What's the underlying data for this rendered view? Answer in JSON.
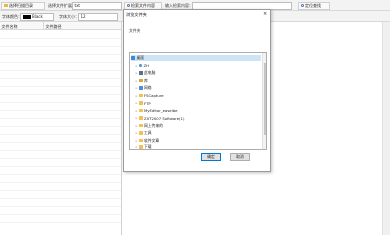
{
  "toolbar": {
    "select_dir_button": "选择扫描目录",
    "file_type_label": "选择文件扩展名：",
    "file_type_value": "txt",
    "search_button": "检索文件内容",
    "search_input_label": "输入检索内容：",
    "locate_button": "定位查找"
  },
  "options": {
    "text_color_label": "字体颜色：",
    "text_color_name": "Black",
    "text_color_value": "#000000",
    "font_size_label": "字体大小：",
    "font_size_value": "12"
  },
  "file_list": {
    "columns": [
      "文件名称",
      "文件路径"
    ]
  },
  "dialog": {
    "title": "浏览文件夹",
    "close": "×",
    "prompt": "文件夹",
    "tree": [
      {
        "label": "桌面",
        "icon": "desktop-icon",
        "level": 0,
        "selected": true
      },
      {
        "label": "ZH",
        "icon": "user-icon",
        "level": 1
      },
      {
        "label": "此电脑",
        "icon": "computer-icon",
        "level": 1
      },
      {
        "label": "库",
        "icon": "library-icon",
        "level": 1
      },
      {
        "label": "网络",
        "icon": "network-icon",
        "level": 1
      },
      {
        "label": "FSCapture",
        "icon": "folder-icon",
        "level": 1
      },
      {
        "label": "FTP",
        "icon": "folder-icon",
        "level": 1
      },
      {
        "label": "MyEditor_easelbe",
        "icon": "folder-icon",
        "level": 1
      },
      {
        "label": "ZXT2007 Software(1)",
        "icon": "folder-icon",
        "level": 1
      },
      {
        "label": "网上传来的",
        "icon": "folder-icon",
        "level": 1
      },
      {
        "label": "工具",
        "icon": "folder-icon",
        "level": 1
      },
      {
        "label": "软件文章",
        "icon": "folder-icon",
        "level": 1
      },
      {
        "label": "下载",
        "icon": "folder-icon",
        "level": 1
      }
    ],
    "ok": "确定",
    "cancel": "取消"
  }
}
